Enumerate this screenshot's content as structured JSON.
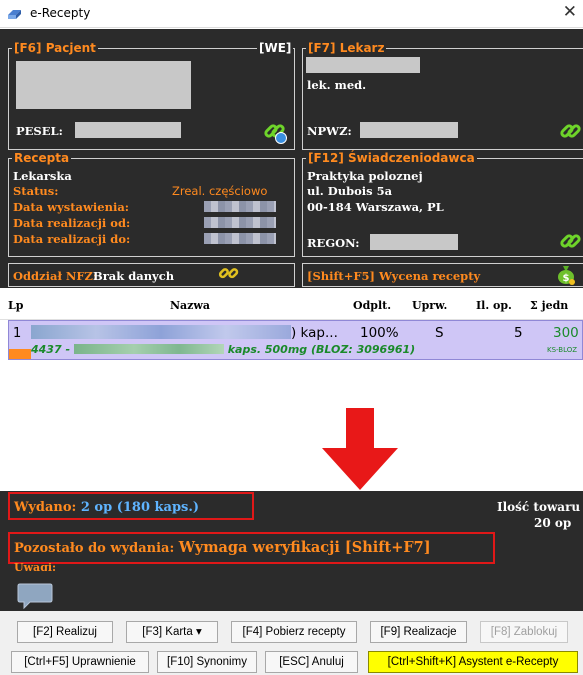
{
  "window": {
    "title": "e-Recepty",
    "close_glyph": "✕"
  },
  "pacjent": {
    "legend": "[F6] Pacjent",
    "we_label": "[WE]",
    "pesel_label": "PESEL:"
  },
  "lekarz": {
    "legend": "[F7] Lekarz",
    "title": "lek. med.",
    "npwz_label": "NPWZ:"
  },
  "recepta": {
    "legend": "Recepta",
    "type": "Lekarska",
    "status_label": "Status:",
    "status_value": "Zreal. częściowo",
    "data_wystawienia_label": "Data wystawienia:",
    "data_realizacji_od_label": "Data realizacji od:",
    "data_realizacji_do_label": "Data realizacji do:"
  },
  "swiadczeniodawca": {
    "legend": "[F12] Świadczeniodawca",
    "name": "Praktyka polozne",
    "name_suffix": "j",
    "address1": "ul. Dubois 5a",
    "address2": "00-184 Warszawa, PL",
    "regon_label": "REGON:"
  },
  "nfz": {
    "label": "Oddział NFZ:",
    "value": "Brak danych"
  },
  "wycena": {
    "label": "[Shift+F5] Wycena recepty"
  },
  "table": {
    "headers": [
      "Lp",
      "Nazwa",
      "Odplt.",
      "Uprw.",
      "Il. op.",
      "Σ jedn"
    ],
    "row": {
      "lp": "1",
      "name_suffix": ") kap...",
      "odplatnosc": "100%",
      "uprawnienie": "S",
      "ilosc_op": "5",
      "suma_jedn": "300",
      "sub_prefix": "4437 -",
      "sub_suffix": "kaps. 500mg (BLOZ: 3096961)",
      "ks_label": "KS-BLOZ"
    }
  },
  "summary": {
    "wydano_label": "Wydano:",
    "wydano_value": "2 op (180 kaps.)",
    "ilosc_label": "Ilość towaru",
    "ilosc_value": "20 op",
    "pozostalo_label": "Pozostało do wydania:",
    "pozostalo_value": "Wymaga weryfikacji [Shift+F7]",
    "uwagi_label": "Uwagi:"
  },
  "buttons": {
    "realizuj": "[F2] Realizuj",
    "karta": "[F3] Karta ▾",
    "pobierz": "[F4] Pobierz recepty",
    "realizacje": "[F9] Realizacje",
    "zablokuj": "[F8] Zablokuj",
    "uprawnienie": "[Ctrl+F5] Uprawnienie",
    "synonimy": "[F10] Synonimy",
    "anuluj": "[ESC] Anuluj",
    "asystent": "[Ctrl+Shift+K] Asystent e-Recepty"
  },
  "colors": {
    "panel_bg": "#2b2b2b",
    "label_orange": "#ff8a1f",
    "highlight_red": "#e01818",
    "row_bg": "#cfc6f6",
    "wydano_blue": "#5fb4ff",
    "asystent_yellow": "#ffff00"
  },
  "icons": {
    "app": "prescription-app-icon",
    "link": "chain-link-icon",
    "money": "money-bag-icon",
    "chat": "chat-bubble-icon",
    "arrow": "down-arrow-icon"
  }
}
